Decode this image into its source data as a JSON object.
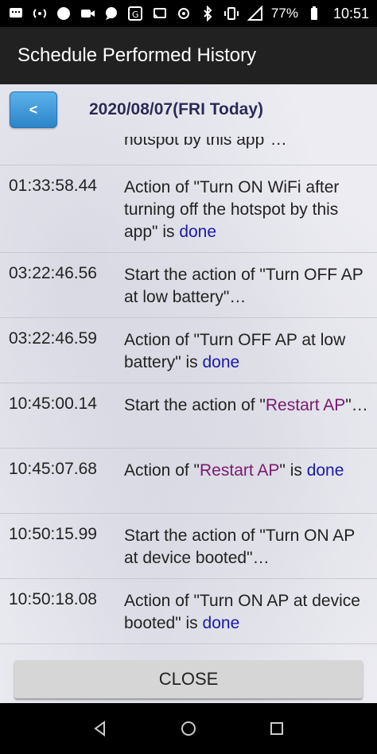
{
  "status_bar": {
    "battery": "77%",
    "time": "10:51",
    "icons_left": [
      "notification-icon",
      "hotspot-icon",
      "circle-icon",
      "camera-icon",
      "chat-icon",
      "translate-icon"
    ],
    "icons_right": [
      "cast-icon",
      "hotspot-icon",
      "bluetooth-icon",
      "vibrate-icon",
      "signal-icon",
      "battery-icon"
    ]
  },
  "app_bar": {
    "title": "Schedule Performed History"
  },
  "date_bar": {
    "back_label": "<",
    "date": "2020/08/07(FRI Today)"
  },
  "history": [
    {
      "time": "",
      "desc_parts": [
        {
          "text": "hotspot by this app\"…",
          "cls": ""
        }
      ]
    },
    {
      "time": "01:33:58.44",
      "desc_parts": [
        {
          "text": "Action of \"Turn ON WiFi after turning off the hotspot by this app\" is ",
          "cls": ""
        },
        {
          "text": "done",
          "cls": "done"
        }
      ]
    },
    {
      "time": "03:22:46.56",
      "desc_parts": [
        {
          "text": "Start the action of \"Turn OFF AP at low battery\"…",
          "cls": ""
        }
      ]
    },
    {
      "time": "03:22:46.59",
      "desc_parts": [
        {
          "text": "Action of \"Turn OFF AP at low battery\" is ",
          "cls": ""
        },
        {
          "text": "done",
          "cls": "done"
        }
      ]
    },
    {
      "time": "10:45:00.14",
      "desc_parts": [
        {
          "text": "Start the action of \"",
          "cls": ""
        },
        {
          "text": "Restart AP",
          "cls": "restart"
        },
        {
          "text": "\"…",
          "cls": ""
        }
      ]
    },
    {
      "time": "10:45:07.68",
      "desc_parts": [
        {
          "text": "Action of \"",
          "cls": ""
        },
        {
          "text": "Restart AP",
          "cls": "restart"
        },
        {
          "text": "\" is ",
          "cls": ""
        },
        {
          "text": "done",
          "cls": "done"
        }
      ]
    },
    {
      "time": "10:50:15.99",
      "desc_parts": [
        {
          "text": "Start the action of \"Turn ON AP at device booted\"…",
          "cls": ""
        }
      ]
    },
    {
      "time": "10:50:18.08",
      "desc_parts": [
        {
          "text": "Action of \"Turn ON AP at device booted\" is ",
          "cls": ""
        },
        {
          "text": "done",
          "cls": "done"
        }
      ]
    }
  ],
  "close_label": "CLOSE",
  "nav": {
    "back": "back-icon",
    "home": "home-icon",
    "recents": "recents-icon"
  }
}
